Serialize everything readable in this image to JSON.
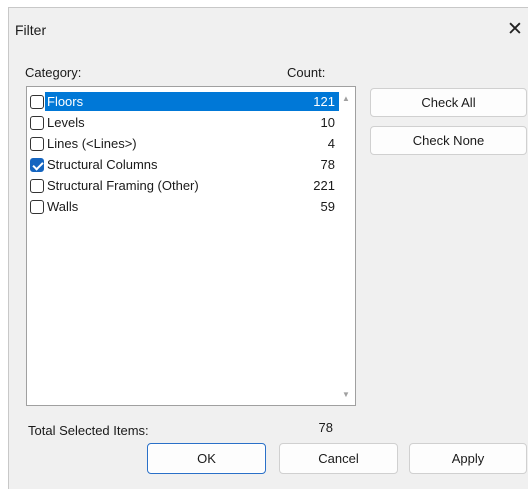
{
  "window": {
    "title": "Filter",
    "close_glyph": "✕",
    "close_icon": "close-icon"
  },
  "list": {
    "category_header": "Category:",
    "count_header": "Count:",
    "items": [
      {
        "label": "Floors",
        "count": "121",
        "checked": false,
        "selected": true
      },
      {
        "label": "Levels",
        "count": "10",
        "checked": false,
        "selected": false
      },
      {
        "label": "Lines (<Lines>)",
        "count": "4",
        "checked": false,
        "selected": false
      },
      {
        "label": "Structural Columns",
        "count": "78",
        "checked": true,
        "selected": false
      },
      {
        "label": "Structural Framing (Other)",
        "count": "221",
        "checked": false,
        "selected": false
      },
      {
        "label": "Walls",
        "count": "59",
        "checked": false,
        "selected": false
      }
    ],
    "scroll_up_glyph": "▲",
    "scroll_down_glyph": "▼"
  },
  "side_buttons": {
    "check_all": "Check All",
    "check_none": "Check None"
  },
  "footer": {
    "total_label": "Total Selected Items:",
    "total_value": "78",
    "ok": "OK",
    "cancel": "Cancel",
    "apply": "Apply"
  },
  "colors": {
    "selection": "#0078d7",
    "checkbox_checked": "#1565c0",
    "dialog_bg": "#f0f0f0",
    "default_button_border": "#2a70c8"
  }
}
